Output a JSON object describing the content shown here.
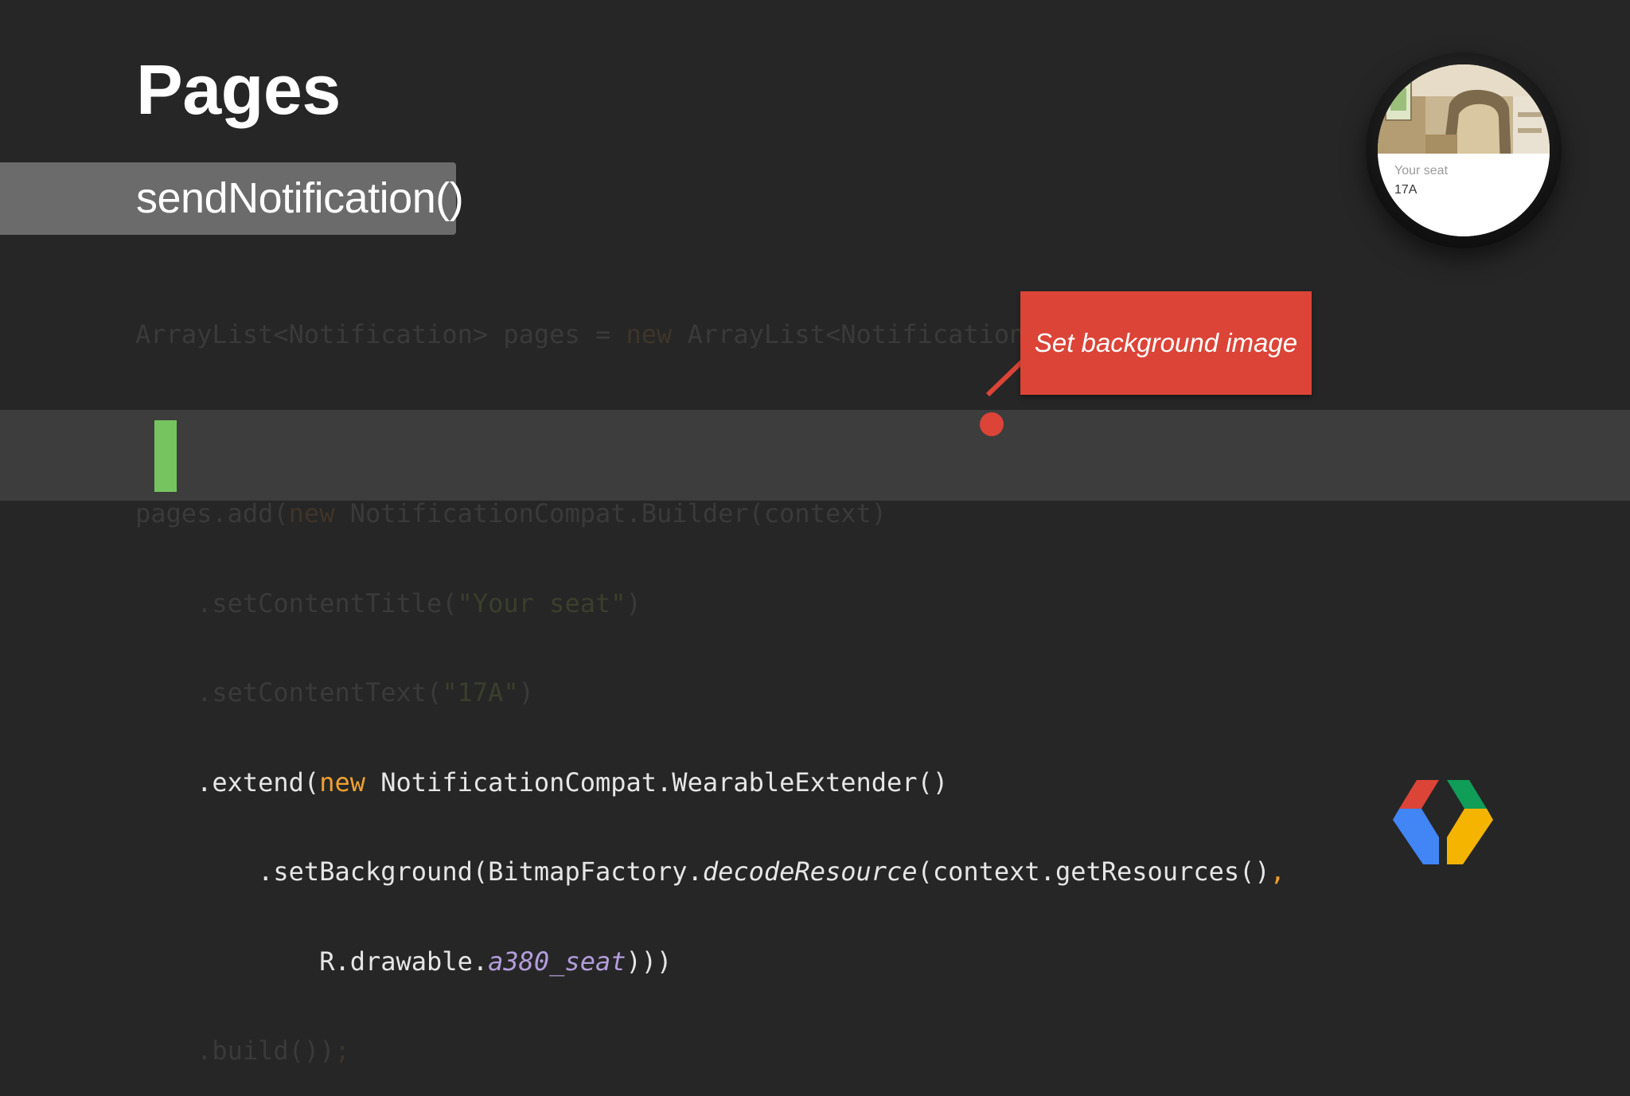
{
  "slide": {
    "title": "Pages",
    "subtitle": "sendNotification()"
  },
  "code": {
    "line1": {
      "a": "ArrayList<Notification> pages = ",
      "kw": "new",
      "b": " ArrayList<Notification>();"
    },
    "line3": {
      "a": "pages.add(",
      "kw": "new",
      "b": " NotificationCompat.Builder(context)"
    },
    "line4": {
      "a": "    .setContentTitle(",
      "str": "\"Your seat\"",
      "b": ")"
    },
    "line5": {
      "a": "    .setContentText(",
      "str": "\"17A\"",
      "b": ")"
    },
    "line6": {
      "a": "    .extend(",
      "kw": "new",
      "b": " NotificationCompat.WearableExtender()"
    },
    "line7": {
      "a": "        .setBackground(BitmapFactory.",
      "it": "decodeResource",
      "b": "(context.getResources()",
      "comma": ","
    },
    "line8": {
      "a": "            R.drawable.",
      "it": "a380_seat",
      "b": ")))"
    },
    "line9": {
      "a": "    .build())",
      "semi": ";"
    }
  },
  "callout": {
    "text": "Set background image",
    "color": "#db4437"
  },
  "watch": {
    "label": "Your seat",
    "value": "17A"
  },
  "logo": {
    "icon": "chrome-developers-logo-icon",
    "colors": [
      "#db4437",
      "#0f9d58",
      "#4285f4",
      "#f4b400"
    ]
  },
  "colors": {
    "background": "#262626",
    "highlight_band": "#3d3d3d",
    "highlight_marker": "#76c460",
    "keyword": "#f0a030",
    "identifier_italic": "#b39ddb"
  }
}
